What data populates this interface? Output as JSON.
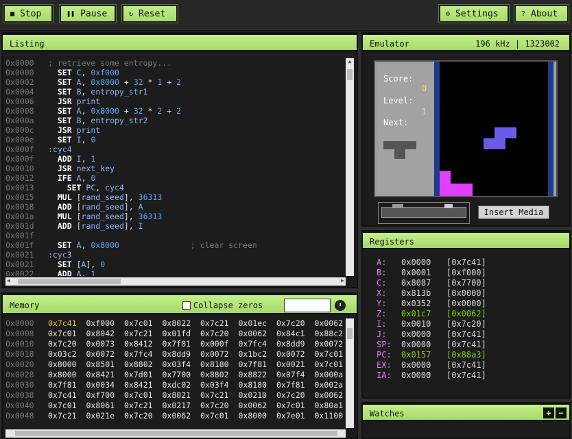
{
  "toolbar": {
    "stop": "Stop",
    "pause": "Pause",
    "reset": "Reset",
    "settings": "Settings",
    "about": "About"
  },
  "listing": {
    "title": "Listing",
    "lines": [
      {
        "addr": "0x0000",
        "text": "; retrieve some entropy...",
        "type": "comment"
      },
      {
        "addr": "0x0000",
        "text": "  SET C, 0xf000",
        "type": "code"
      },
      {
        "addr": "0x0002",
        "text": "  SET A, 0x8000 + 32 * 1 + 2",
        "type": "code"
      },
      {
        "addr": "0x0004",
        "text": "  SET B, entropy_str1",
        "type": "code"
      },
      {
        "addr": "0x0006",
        "text": "  JSR print",
        "type": "code"
      },
      {
        "addr": "0x0008",
        "text": "  SET A, 0x8000 + 32 * 2 + 2",
        "type": "code"
      },
      {
        "addr": "0x000a",
        "text": "  SET B, entropy_str2",
        "type": "code"
      },
      {
        "addr": "0x000c",
        "text": "  JSR print",
        "type": "code"
      },
      {
        "addr": "0x000e",
        "text": "  SET I, 0",
        "type": "code"
      },
      {
        "addr": "0x000f",
        "text": ":cyc4",
        "type": "label"
      },
      {
        "addr": "0x000f",
        "text": "  ADD I, 1",
        "type": "code"
      },
      {
        "addr": "0x0010",
        "text": "  JSR next_key",
        "type": "code"
      },
      {
        "addr": "0x0012",
        "text": "  IFE A, 0",
        "type": "code"
      },
      {
        "addr": "0x0013",
        "text": "    SET PC, cyc4",
        "type": "code"
      },
      {
        "addr": "0x0015",
        "text": "  MUL [rand_seed], 36313",
        "type": "code"
      },
      {
        "addr": "0x0018",
        "text": "  ADD [rand_seed], A",
        "type": "code"
      },
      {
        "addr": "0x001a",
        "text": "  MUL [rand_seed], 36313",
        "type": "code"
      },
      {
        "addr": "0x001d",
        "text": "  ADD [rand_seed], I",
        "type": "code"
      },
      {
        "addr": "0x001f",
        "text": "",
        "type": "code"
      },
      {
        "addr": "0x001f",
        "text": "  SET A, 0x8000               ; clear screen",
        "type": "code"
      },
      {
        "addr": "0x0021",
        "text": ":cyc3",
        "type": "label"
      },
      {
        "addr": "0x0021",
        "text": "  SET [A], 0",
        "type": "code"
      },
      {
        "addr": "0x0022",
        "text": "  ADD A, 1",
        "type": "code"
      }
    ]
  },
  "emulator": {
    "title": "Emulator",
    "status": "196 kHz | 1323002",
    "score_label": "Score:",
    "score_value": "0",
    "level_label": "Level:",
    "level_value": "1",
    "next_label": "Next:",
    "insert_media": "Insert Media"
  },
  "memory": {
    "title": "Memory",
    "collapse_label": "Collapse zeros",
    "rows": [
      {
        "addr": "0x0000",
        "vals": [
          "0x7c41",
          "0xf000",
          "0x7c01",
          "0x8022",
          "0x7c21",
          "0x01ec",
          "0x7c20",
          "0x0062"
        ]
      },
      {
        "addr": "0x0008",
        "vals": [
          "0x7c01",
          "0x8042",
          "0x7c21",
          "0x01fd",
          "0x7c20",
          "0x0062",
          "0x84c1",
          "0x88c2"
        ]
      },
      {
        "addr": "0x0010",
        "vals": [
          "0x7c20",
          "0x0073",
          "0x8412",
          "0x7f81",
          "0x000f",
          "0x7fc4",
          "0x8dd9",
          "0x0072"
        ]
      },
      {
        "addr": "0x0018",
        "vals": [
          "0x03c2",
          "0x0072",
          "0x7fc4",
          "0x8dd9",
          "0x0072",
          "0x1bc2",
          "0x0072",
          "0x7c01"
        ]
      },
      {
        "addr": "0x0020",
        "vals": [
          "0x8000",
          "0x8501",
          "0x8802",
          "0x03f4",
          "0x8180",
          "0x7f81",
          "0x0021",
          "0x7c01"
        ]
      },
      {
        "addr": "0x0028",
        "vals": [
          "0x8000",
          "0x8421",
          "0x7d01",
          "0x7700",
          "0x8802",
          "0x8822",
          "0x07f4",
          "0x000a"
        ]
      },
      {
        "addr": "0x0030",
        "vals": [
          "0x7f81",
          "0x0034",
          "0x8421",
          "0xdc02",
          "0x03f4",
          "0x8180",
          "0x7f81",
          "0x002a"
        ]
      },
      {
        "addr": "0x0038",
        "vals": [
          "0x7c41",
          "0xf700",
          "0x7c01",
          "0x8021",
          "0x7c21",
          "0x0210",
          "0x7c20",
          "0x0062"
        ]
      },
      {
        "addr": "0x0040",
        "vals": [
          "0x7c01",
          "0x8061",
          "0x7c21",
          "0x0217",
          "0x7c20",
          "0x0062",
          "0x7c01",
          "0x80a1"
        ]
      },
      {
        "addr": "0x0048",
        "vals": [
          "0x7c21",
          "0x021e",
          "0x7c20",
          "0x0062",
          "0x7c01",
          "0x8000",
          "0x7e01",
          "0x1100"
        ]
      }
    ]
  },
  "registers": {
    "title": "Registers",
    "items": [
      {
        "name": "A:",
        "value": "0x0000",
        "ptr": "[0x7c41]",
        "changed": false
      },
      {
        "name": "B:",
        "value": "0x0001",
        "ptr": "[0xf000]",
        "changed": false
      },
      {
        "name": "C:",
        "value": "0x8087",
        "ptr": "[0x7700]",
        "changed": false
      },
      {
        "name": "X:",
        "value": "0x813b",
        "ptr": "[0x0000]",
        "changed": false
      },
      {
        "name": "Y:",
        "value": "0x0352",
        "ptr": "[0x0000]",
        "changed": false
      },
      {
        "name": "Z:",
        "value": "0x01c7",
        "ptr": "[0x0062]",
        "changed": true
      },
      {
        "name": "I:",
        "value": "0x0010",
        "ptr": "[0x7c20]",
        "changed": false
      },
      {
        "name": "J:",
        "value": "0x0000",
        "ptr": "[0x7c41]",
        "changed": false
      },
      {
        "name": "SP:",
        "value": "0x0000",
        "ptr": "[0x7c41]",
        "changed": false
      },
      {
        "name": "PC:",
        "value": "0x0157",
        "ptr": "[0x88a3]",
        "changed": true
      },
      {
        "name": "EX:",
        "value": "0x0000",
        "ptr": "[0x7c41]",
        "changed": false
      },
      {
        "name": "IA:",
        "value": "0x0000",
        "ptr": "[0x7c41]",
        "changed": false
      }
    ]
  },
  "watches": {
    "title": "Watches",
    "add": "+",
    "remove": "−"
  }
}
